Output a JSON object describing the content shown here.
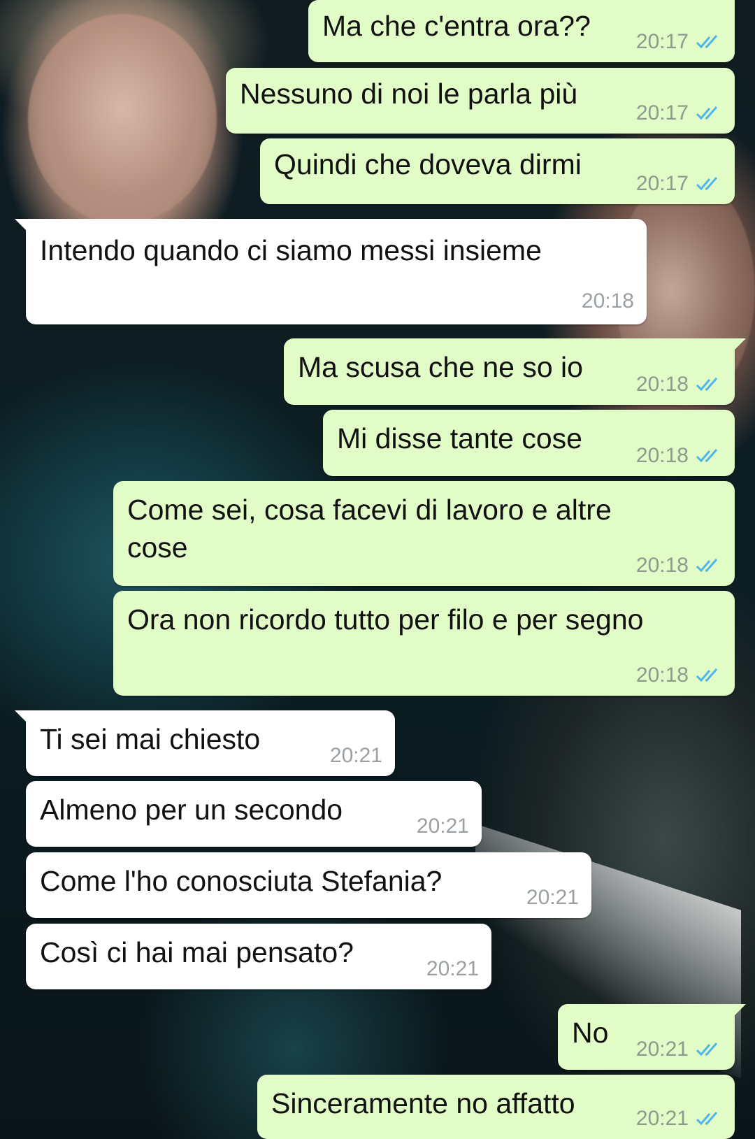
{
  "colors": {
    "outgoing_bubble": "#e1fcc6",
    "incoming_bubble": "#ffffff",
    "read_ticks": "#4fb6ec",
    "timestamp": "#8d9a8d"
  },
  "icons": {
    "read_status": "double-check-icon"
  },
  "messages": [
    {
      "direction": "outgoing",
      "text": "Ma che c'entra ora??",
      "time": "20:17",
      "status": "read"
    },
    {
      "direction": "outgoing",
      "text": "Nessuno di noi le parla più",
      "time": "20:17",
      "status": "read"
    },
    {
      "direction": "outgoing",
      "text": "Quindi che doveva dirmi",
      "time": "20:17",
      "status": "read"
    },
    {
      "direction": "incoming",
      "text": "Intendo quando ci siamo messi insieme",
      "time": "20:18"
    },
    {
      "direction": "outgoing",
      "text": "Ma scusa che ne so io",
      "time": "20:18",
      "status": "read"
    },
    {
      "direction": "outgoing",
      "text": "Mi disse tante cose",
      "time": "20:18",
      "status": "read"
    },
    {
      "direction": "outgoing",
      "text": "Come sei, cosa facevi di lavoro e altre cose",
      "time": "20:18",
      "status": "read"
    },
    {
      "direction": "outgoing",
      "text": "Ora non ricordo tutto per filo e per segno",
      "time": "20:18",
      "status": "read"
    },
    {
      "direction": "incoming",
      "text": "Ti sei mai chiesto",
      "time": "20:21"
    },
    {
      "direction": "incoming",
      "text": "Almeno per un secondo",
      "time": "20:21"
    },
    {
      "direction": "incoming",
      "text": "Come l'ho conosciuta Stefania?",
      "time": "20:21"
    },
    {
      "direction": "incoming",
      "text": "Così ci hai mai pensato?",
      "time": "20:21"
    },
    {
      "direction": "outgoing",
      "text": "No",
      "time": "20:21",
      "status": "read"
    },
    {
      "direction": "outgoing",
      "text": "Sinceramente no affatto",
      "time": "20:21",
      "status": "read"
    }
  ]
}
